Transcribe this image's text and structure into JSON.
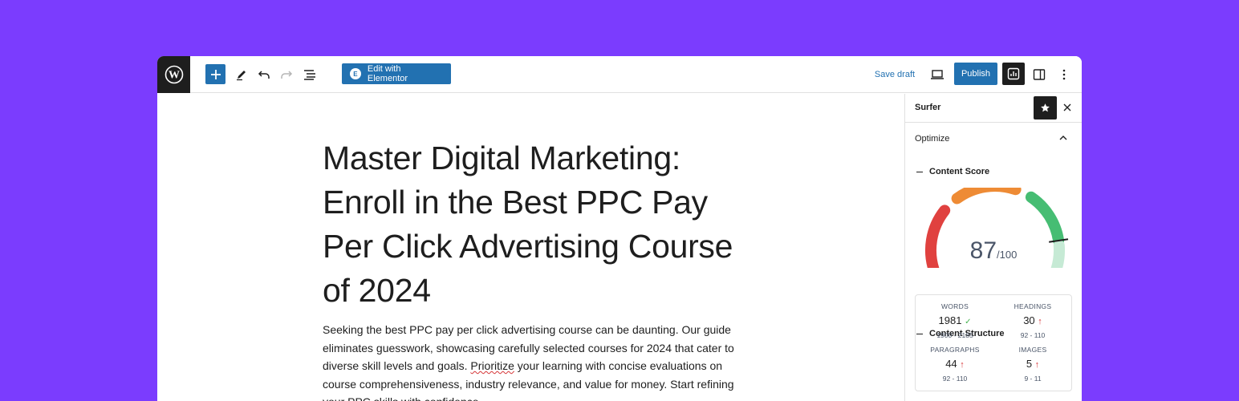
{
  "toolbar": {
    "add_icon": "plus",
    "elementor_label": "Edit with Elementor",
    "elementor_badge": "E",
    "save_draft_label": "Save draft",
    "publish_label": "Publish"
  },
  "post": {
    "title": "Master Digital Marketing: Enroll in the Best PPC Pay Per Click Advertising Course of 2024",
    "body_before": "Seeking the best PPC pay per click advertising course can be daunting. Our guide eliminates guesswork, showcasing carefully selected courses for 2024 that cater to diverse skill levels and goals. ",
    "body_spell": "Prioritize",
    "body_after": " your learning with concise evaluations on course comprehensiveness, industry relevance, and value for money. Start refining your PPC skills with confidence."
  },
  "sidebar": {
    "title": "Surfer",
    "optimize_label": "Optimize",
    "content_score_label": "Content Score",
    "score_value": "87",
    "score_max": "/100",
    "score_fraction": 0.87,
    "content_structure_label": "Content Structure",
    "stats": [
      {
        "label": "WORDS",
        "value": "1981",
        "indicator": "✓",
        "status": "ok",
        "range": "1900 - 2185"
      },
      {
        "label": "HEADINGS",
        "value": "30",
        "indicator": "↑",
        "status": "up",
        "range": "92 - 110"
      },
      {
        "label": "PARAGRAPHS",
        "value": "44",
        "indicator": "↑",
        "status": "up",
        "range": "92 - 110"
      },
      {
        "label": "IMAGES",
        "value": "5",
        "indicator": "↑",
        "status": "up",
        "range": "9 - 11"
      }
    ]
  },
  "colors": {
    "background": "#7b3cfe",
    "accent": "#2271b1",
    "gauge_red": "#e0413f",
    "gauge_orange": "#ee8b35",
    "gauge_green": "#46bd73",
    "gauge_light_green": "#c6ead5"
  }
}
